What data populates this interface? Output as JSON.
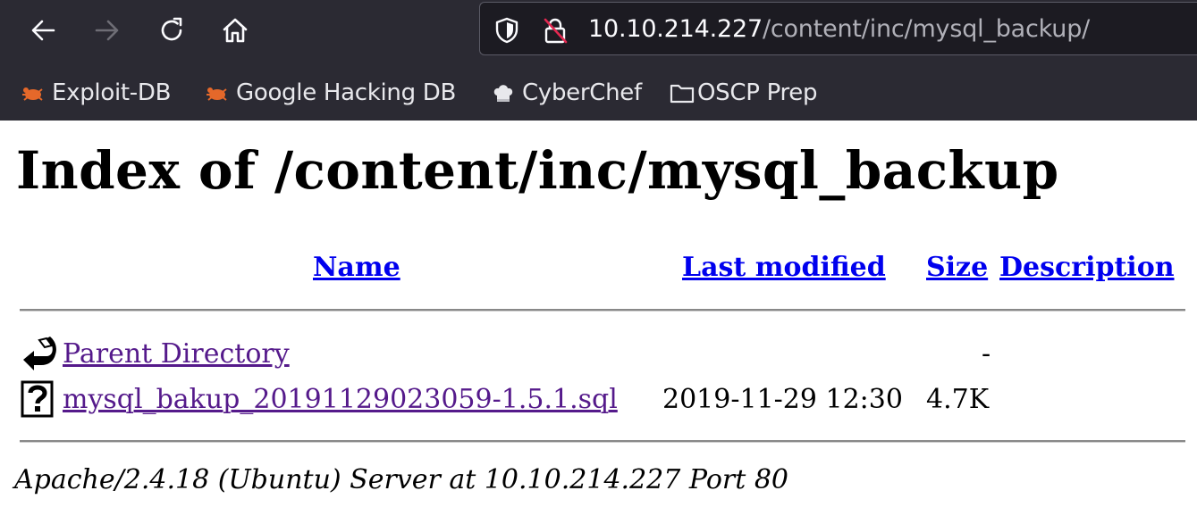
{
  "browser": {
    "url_host": "10.10.214.227",
    "url_path": "/content/inc/mysql_backup/",
    "bookmarks": [
      {
        "label": "Exploit-DB",
        "icon": "bug-icon"
      },
      {
        "label": "Google Hacking DB",
        "icon": "bug-icon"
      },
      {
        "label": "CyberChef",
        "icon": "chef-hat-icon"
      },
      {
        "label": "OSCP Prep",
        "icon": "folder-icon"
      }
    ]
  },
  "page": {
    "title": "Index of /content/inc/mysql_backup",
    "columns": {
      "name": "Name",
      "last_modified": "Last modified",
      "size": "Size",
      "description": "Description"
    },
    "rows": [
      {
        "name": "Parent Directory",
        "last_modified": "",
        "size": "-",
        "description": "",
        "icon": "back-arrow-icon"
      },
      {
        "name": "mysql_bakup_20191129023059-1.5.1.sql",
        "last_modified": "2019-11-29 12:30",
        "size": "4.7K",
        "description": "",
        "icon": "unknown-file-icon"
      }
    ],
    "footer": "Apache/2.4.18 (Ubuntu) Server at 10.10.214.227 Port 80"
  },
  "colors": {
    "chrome_bg": "#2b2a33",
    "urlbar_bg": "#1c1b22",
    "link": "#0000ee",
    "visited_link": "#551a8b"
  }
}
